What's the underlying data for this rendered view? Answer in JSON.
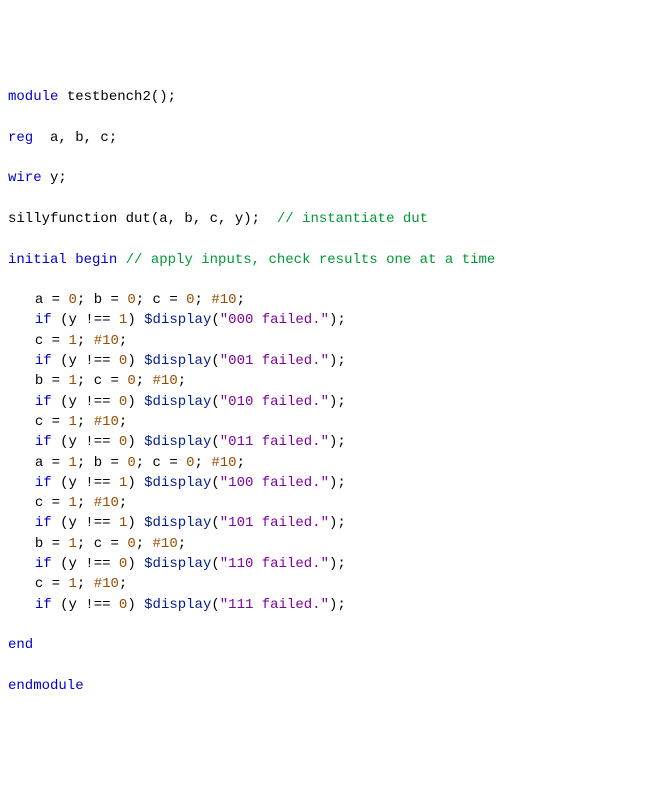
{
  "header": {
    "module_kw": "module",
    "module_name": "testbench2",
    "module_tail": "();",
    "reg_kw": "reg",
    "reg_decl": "  a, b, c;",
    "wire_kw": "wire",
    "wire_decl": " y;",
    "inst_type": "sillyfunction dut",
    "inst_args": "(a, b, c, y);  ",
    "inst_cmt": "// instantiate dut",
    "initial_kw": "initial",
    "begin_kw": "begin",
    "begin_cmt": " // apply inputs, check results one at a time"
  },
  "tests": [
    {
      "driveA": "a = ",
      "va": "0",
      "sep1": "; b = ",
      "vb": "0",
      "sep2": "; c = ",
      "vc": "0",
      "tail": "; ",
      "delay_hash": "#",
      "delay": "10",
      "semi": ";",
      "ifkw": "if",
      "open": " (y ",
      "neq": "!==",
      "sp": " ",
      "expect": "1",
      "close": ") ",
      "disp": "$display",
      "dopen": "(",
      "msg": "\"000 failed.\"",
      "dclose": ");"
    },
    {
      "driveA": "c = ",
      "va": "1",
      "sep1": "",
      "vb": "",
      "sep2": "",
      "vc": "",
      "tail": "; ",
      "delay_hash": "#",
      "delay": "10",
      "semi": ";",
      "ifkw": "if",
      "open": " (y ",
      "neq": "!==",
      "sp": " ",
      "expect": "0",
      "close": ") ",
      "disp": "$display",
      "dopen": "(",
      "msg": "\"001 failed.\"",
      "dclose": ");"
    },
    {
      "driveA": "b = ",
      "va": "1",
      "sep1": "; c = ",
      "vb": "0",
      "sep2": "",
      "vc": "",
      "tail": "; ",
      "delay_hash": "#",
      "delay": "10",
      "semi": ";",
      "ifkw": "if",
      "open": " (y ",
      "neq": "!==",
      "sp": " ",
      "expect": "0",
      "close": ") ",
      "disp": "$display",
      "dopen": "(",
      "msg": "\"010 failed.\"",
      "dclose": ");"
    },
    {
      "driveA": "c = ",
      "va": "1",
      "sep1": "",
      "vb": "",
      "sep2": "",
      "vc": "",
      "tail": "; ",
      "delay_hash": "#",
      "delay": "10",
      "semi": ";",
      "ifkw": "if",
      "open": " (y ",
      "neq": "!==",
      "sp": " ",
      "expect": "0",
      "close": ") ",
      "disp": "$display",
      "dopen": "(",
      "msg": "\"011 failed.\"",
      "dclose": ");"
    },
    {
      "driveA": "a = ",
      "va": "1",
      "sep1": "; b = ",
      "vb": "0",
      "sep2": "; c = ",
      "vc": "0",
      "tail": "; ",
      "delay_hash": "#",
      "delay": "10",
      "semi": ";",
      "ifkw": "if",
      "open": " (y ",
      "neq": "!==",
      "sp": " ",
      "expect": "1",
      "close": ") ",
      "disp": "$display",
      "dopen": "(",
      "msg": "\"100 failed.\"",
      "dclose": ");"
    },
    {
      "driveA": "c = ",
      "va": "1",
      "sep1": "",
      "vb": "",
      "sep2": "",
      "vc": "",
      "tail": "; ",
      "delay_hash": "#",
      "delay": "10",
      "semi": ";",
      "ifkw": "if",
      "open": " (y ",
      "neq": "!==",
      "sp": " ",
      "expect": "1",
      "close": ") ",
      "disp": "$display",
      "dopen": "(",
      "msg": "\"101 failed.\"",
      "dclose": ");"
    },
    {
      "driveA": "b = ",
      "va": "1",
      "sep1": "; c = ",
      "vb": "0",
      "sep2": "",
      "vc": "",
      "tail": "; ",
      "delay_hash": "#",
      "delay": "10",
      "semi": ";",
      "ifkw": "if",
      "open": " (y ",
      "neq": "!==",
      "sp": " ",
      "expect": "0",
      "close": ") ",
      "disp": "$display",
      "dopen": "(",
      "msg": "\"110 failed.\"",
      "dclose": ");"
    },
    {
      "driveA": "c = ",
      "va": "1",
      "sep1": "",
      "vb": "",
      "sep2": "",
      "vc": "",
      "tail": "; ",
      "delay_hash": "#",
      "delay": "10",
      "semi": ";",
      "ifkw": "if",
      "open": " (y ",
      "neq": "!==",
      "sp": " ",
      "expect": "0",
      "close": ") ",
      "disp": "$display",
      "dopen": "(",
      "msg": "\"111 failed.\"",
      "dclose": ");"
    }
  ],
  "footer": {
    "end_kw": "end",
    "endmodule_kw": "endmodule"
  }
}
